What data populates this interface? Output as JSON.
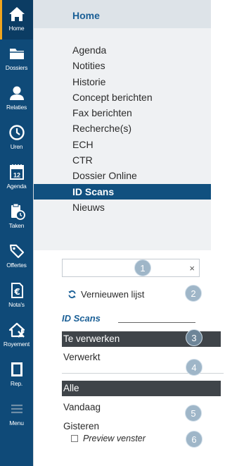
{
  "rail": {
    "items": [
      {
        "label": "Home",
        "icon": "home-icon"
      },
      {
        "label": "Dossiers",
        "icon": "folder-icon"
      },
      {
        "label": "Relaties",
        "icon": "user-icon"
      },
      {
        "label": "Uren",
        "icon": "clock-icon"
      },
      {
        "label": "Agenda",
        "icon": "calendar-icon",
        "day": "12"
      },
      {
        "label": "Taken",
        "icon": "clipboard-clock-icon"
      },
      {
        "label": "Offertes",
        "icon": "tag-icon"
      },
      {
        "label": "Nota's",
        "icon": "euro-doc-icon"
      },
      {
        "label": "Royement",
        "icon": "house-x-icon"
      },
      {
        "label": "Rep.",
        "icon": "book-icon"
      },
      {
        "label": "Menu",
        "icon": "hamburger-icon"
      }
    ]
  },
  "nav": {
    "title": "Home",
    "items": [
      "Agenda",
      "Notities",
      "Historie",
      "Concept berichten",
      "Fax berichten",
      "Recherche(s)",
      "ECH",
      "CTR",
      "Dossier Online",
      "ID Scans",
      "Nieuws"
    ],
    "selected": "ID Scans"
  },
  "search": {
    "value": "",
    "clear": "×"
  },
  "refresh_label": "Vernieuwen lijst",
  "section_title": "ID Scans",
  "status_filters": [
    "Te verwerken",
    "Verwerkt"
  ],
  "date_filters": [
    "Alle",
    "Vandaag",
    "Gisteren"
  ],
  "preview_label": "Preview venster",
  "badges": [
    "1",
    "2",
    "3",
    "4",
    "5",
    "6"
  ],
  "colors": {
    "rail": "#0f4a78",
    "accent": "#1a5f96",
    "selected": "#11507f",
    "dark_row": "#3f4449",
    "badge": "#9fb6c8"
  }
}
